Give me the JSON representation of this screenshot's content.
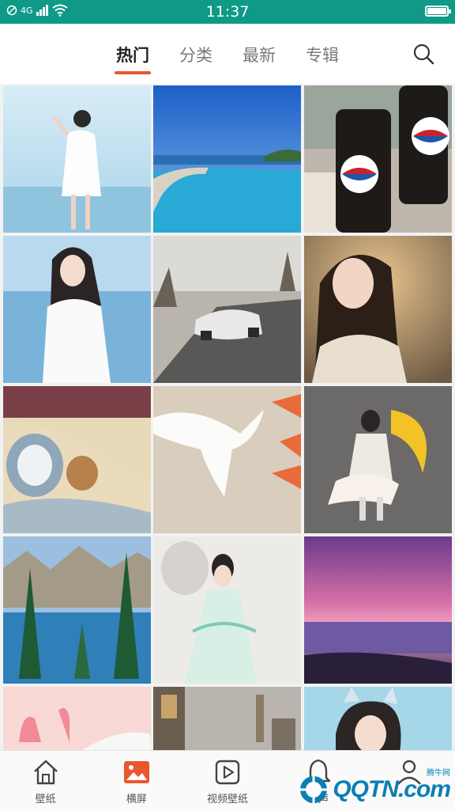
{
  "status_bar": {
    "time": "11:37",
    "network": "4G",
    "battery_level": 1.0
  },
  "tabs": [
    {
      "label": "热门",
      "active": true
    },
    {
      "label": "分类",
      "active": false
    },
    {
      "label": "最新",
      "active": false
    },
    {
      "label": "专辑",
      "active": false
    }
  ],
  "grid_items": [
    {
      "subject": "girl in white dress on beach"
    },
    {
      "subject": "infinity pool and sea"
    },
    {
      "subject": "Pepsi Cola bottles"
    },
    {
      "subject": "girl in white dress by sea"
    },
    {
      "subject": "white sports car on road"
    },
    {
      "subject": "girl with glasses"
    },
    {
      "subject": "Tom and Jerry sleeping"
    },
    {
      "subject": "white dove"
    },
    {
      "subject": "anime warrior girl"
    },
    {
      "subject": "mountain lake with pines"
    },
    {
      "subject": "fantasy girl in white"
    },
    {
      "subject": "pink sunset over sea"
    },
    {
      "subject": "pink hands illustration"
    },
    {
      "subject": "building street"
    },
    {
      "subject": "girl with cat ears"
    }
  ],
  "bottom_nav": [
    {
      "label": "壁纸",
      "icon": "home-icon",
      "active": false
    },
    {
      "label": "横屏",
      "icon": "image-icon",
      "active": true
    },
    {
      "label": "视频壁纸",
      "icon": "video-icon",
      "active": false
    },
    {
      "label": "铃声",
      "icon": "bell-icon",
      "active": false
    },
    {
      "label": "",
      "icon": "user-icon",
      "active": false
    }
  ],
  "watermark": {
    "text": "QQTN.com",
    "small": "腾牛网"
  },
  "colors": {
    "status_bar": "#0e9a86",
    "accent": "#e8572d"
  }
}
